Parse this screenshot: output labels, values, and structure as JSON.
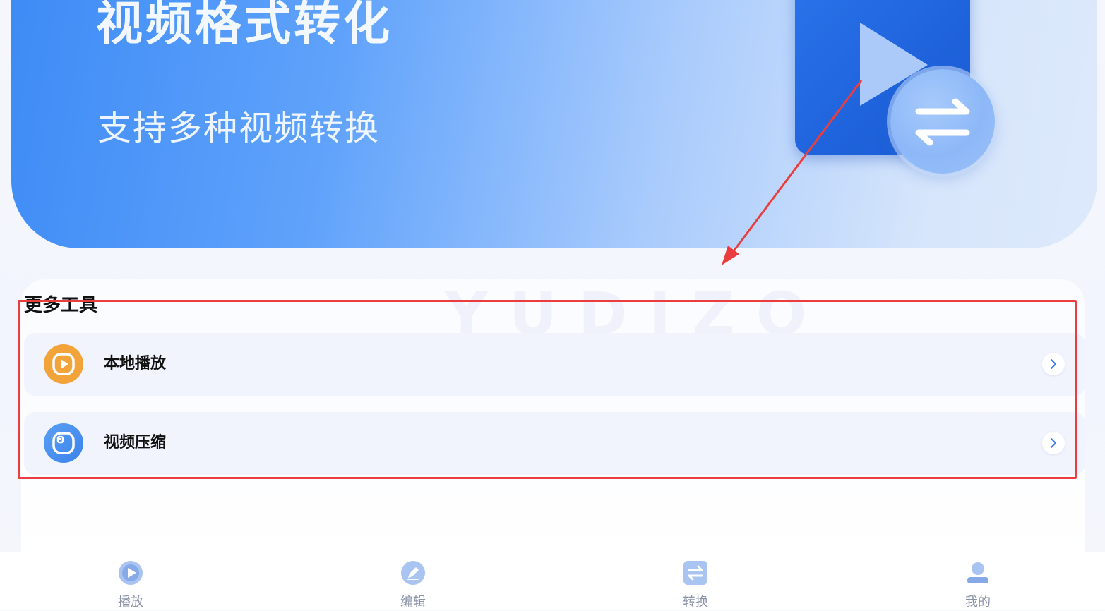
{
  "banner": {
    "title": "视频格式转化",
    "subtitle": "支持多种视频转换",
    "icons": [
      "video-play-icon",
      "convert-arrows-icon"
    ]
  },
  "tools": {
    "section_title": "更多工具",
    "items": [
      {
        "label": "本地播放",
        "icon": "play-circle-icon",
        "color": "#f2a43a"
      },
      {
        "label": "视频压缩",
        "icon": "compress-icon",
        "color": "#4b8ff0"
      }
    ]
  },
  "annotations": {
    "highlight_color": "#ea3e3e"
  },
  "bottom_nav": {
    "items": [
      {
        "label": "播放",
        "icon": "play-icon"
      },
      {
        "label": "编辑",
        "icon": "edit-icon"
      },
      {
        "label": "转换",
        "icon": "convert-icon"
      },
      {
        "label": "我的",
        "icon": "user-icon"
      }
    ]
  },
  "colors": {
    "accent": "#3d8bf6",
    "nav_inactive": "#8a93a8"
  }
}
